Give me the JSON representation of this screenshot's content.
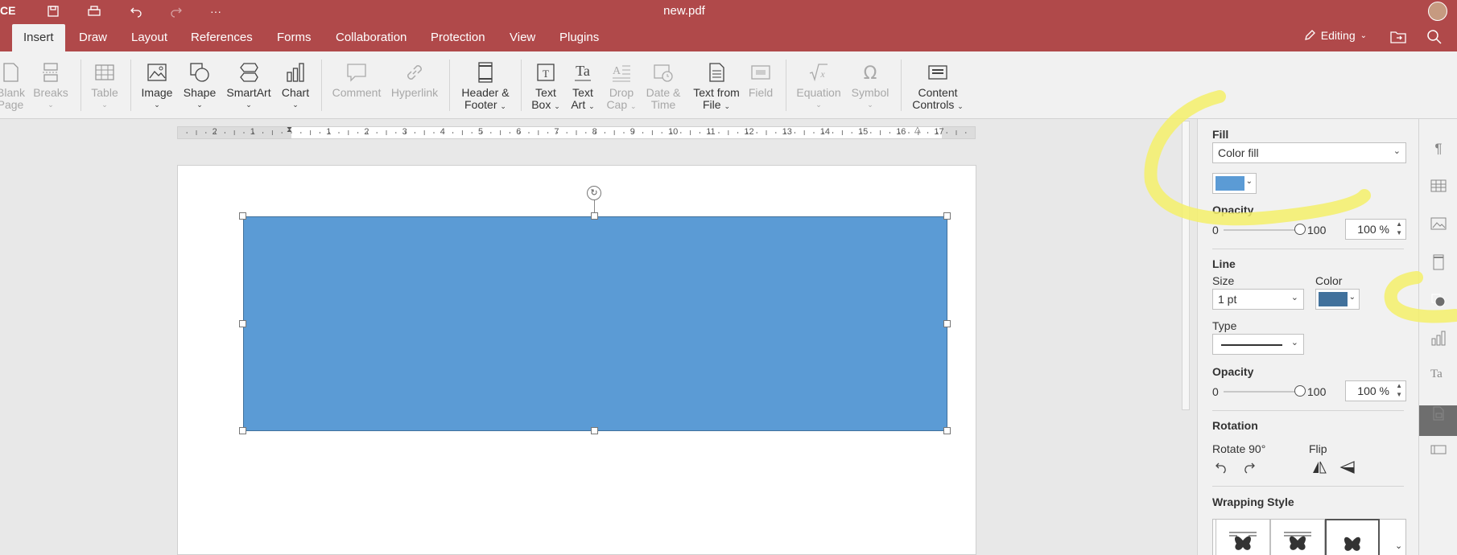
{
  "titlebar": {
    "brand": "CE",
    "document_title": "new.pdf",
    "quick_access": [
      {
        "name": "save-icon"
      },
      {
        "name": "print-icon"
      },
      {
        "name": "undo-icon"
      },
      {
        "name": "redo-icon"
      },
      {
        "name": "more-icon",
        "label": "···"
      }
    ]
  },
  "tabs": [
    {
      "label": "Insert",
      "active": true
    },
    {
      "label": "Draw"
    },
    {
      "label": "Layout"
    },
    {
      "label": "References"
    },
    {
      "label": "Forms"
    },
    {
      "label": "Collaboration"
    },
    {
      "label": "Protection"
    },
    {
      "label": "View"
    },
    {
      "label": "Plugins"
    }
  ],
  "editing_label": "Editing",
  "toolbar": {
    "blank_page": [
      "Blank",
      "Page"
    ],
    "breaks": "Breaks",
    "table": "Table",
    "image": "Image",
    "shape": "Shape",
    "smartart": "SmartArt",
    "chart": "Chart",
    "comment": "Comment",
    "hyperlink": "Hyperlink",
    "header_footer": [
      "Header &",
      "Footer"
    ],
    "text_box": [
      "Text",
      "Box"
    ],
    "text_art": [
      "Text",
      "Art"
    ],
    "drop_cap": [
      "Drop",
      "Cap"
    ],
    "date_time": [
      "Date &",
      "Time"
    ],
    "text_from_file": [
      "Text from",
      "File"
    ],
    "field": "Field",
    "equation": "Equation",
    "symbol": "Symbol",
    "content_controls": [
      "Content",
      "Controls"
    ]
  },
  "ruler": {
    "labels": [
      "2",
      "1",
      "1",
      "2",
      "3",
      "4",
      "5",
      "6",
      "7",
      "8",
      "9",
      "10",
      "11",
      "12",
      "13",
      "14",
      "15",
      "16",
      "17"
    ]
  },
  "shape": {
    "fill_color": "#5b9bd5",
    "line_color": "#41719c"
  },
  "panel": {
    "fill_title": "Fill",
    "fill_type": "Color fill",
    "fill_swatch": "#5b9bd5",
    "opacity_title": "Opacity",
    "opacity_min": "0",
    "opacity_max": "100",
    "opacity_value": "100 %",
    "line_title": "Line",
    "size_label": "Size",
    "size_value": "1 pt",
    "color_label": "Color",
    "line_swatch": "#41719c",
    "type_label": "Type",
    "line_opacity_title": "Opacity",
    "line_opacity_min": "0",
    "line_opacity_max": "100",
    "line_opacity_value": "100 %",
    "rotation_title": "Rotation",
    "rotate_label": "Rotate 90°",
    "flip_label": "Flip",
    "wrapping_title": "Wrapping Style"
  },
  "sidebar": [
    {
      "name": "paragraph-settings-icon"
    },
    {
      "name": "table-settings-icon"
    },
    {
      "name": "image-settings-icon"
    },
    {
      "name": "header-footer-settings-icon"
    },
    {
      "name": "shape-settings-icon",
      "active": true
    },
    {
      "name": "chart-settings-icon"
    },
    {
      "name": "text-art-settings-icon"
    },
    {
      "name": "mail-merge-icon"
    },
    {
      "name": "form-settings-icon"
    }
  ],
  "colors": {
    "header": "#b0494a",
    "highlight": "#f5f06a"
  }
}
